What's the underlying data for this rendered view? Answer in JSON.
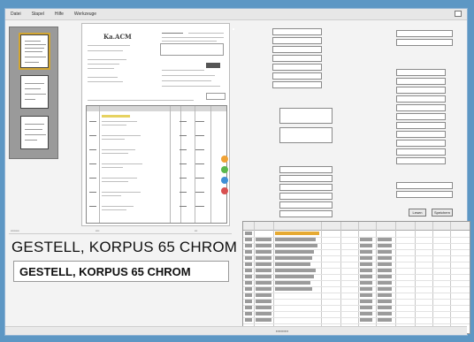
{
  "menu": [
    "Datei",
    "Stapel",
    "Hilfe",
    "Werkzeuge"
  ],
  "doc": {
    "logo": "Ka.ACM"
  },
  "big_text": "GESTELL, KORPUS 65 CHROM",
  "field_text": "GESTELL, KORPUS 65 CHROM",
  "buttons": {
    "left": "Lesen",
    "right": "Speichern"
  }
}
